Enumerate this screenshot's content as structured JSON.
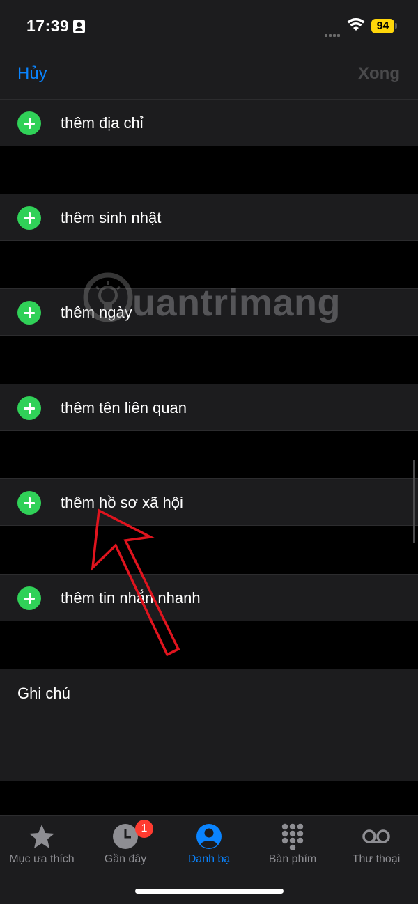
{
  "status": {
    "time": "17:39",
    "battery": "94"
  },
  "nav": {
    "cancel": "Hủy",
    "done": "Xong"
  },
  "rows": [
    {
      "label": "thêm địa chỉ"
    },
    {
      "label": "thêm sinh nhật"
    },
    {
      "label": "thêm ngày"
    },
    {
      "label": "thêm tên liên quan"
    },
    {
      "label": "thêm hồ sơ xã hội"
    },
    {
      "label": "thêm tin nhắn nhanh"
    }
  ],
  "notes": {
    "label": "Ghi chú"
  },
  "watermark": {
    "text": "uantrimang"
  },
  "tabs": [
    {
      "label": "Mục ưa thích",
      "icon": "star-icon"
    },
    {
      "label": "Gần đây",
      "icon": "clock-icon",
      "badge": "1"
    },
    {
      "label": "Danh bạ",
      "icon": "person-circle-icon",
      "active": true
    },
    {
      "label": "Bàn phím",
      "icon": "keypad-icon"
    },
    {
      "label": "Thư thoại",
      "icon": "voicemail-icon"
    }
  ],
  "colors": {
    "accent": "#0a84ff",
    "add": "#30d158",
    "badge": "#ff3b30",
    "arrow": "#e0141e"
  }
}
